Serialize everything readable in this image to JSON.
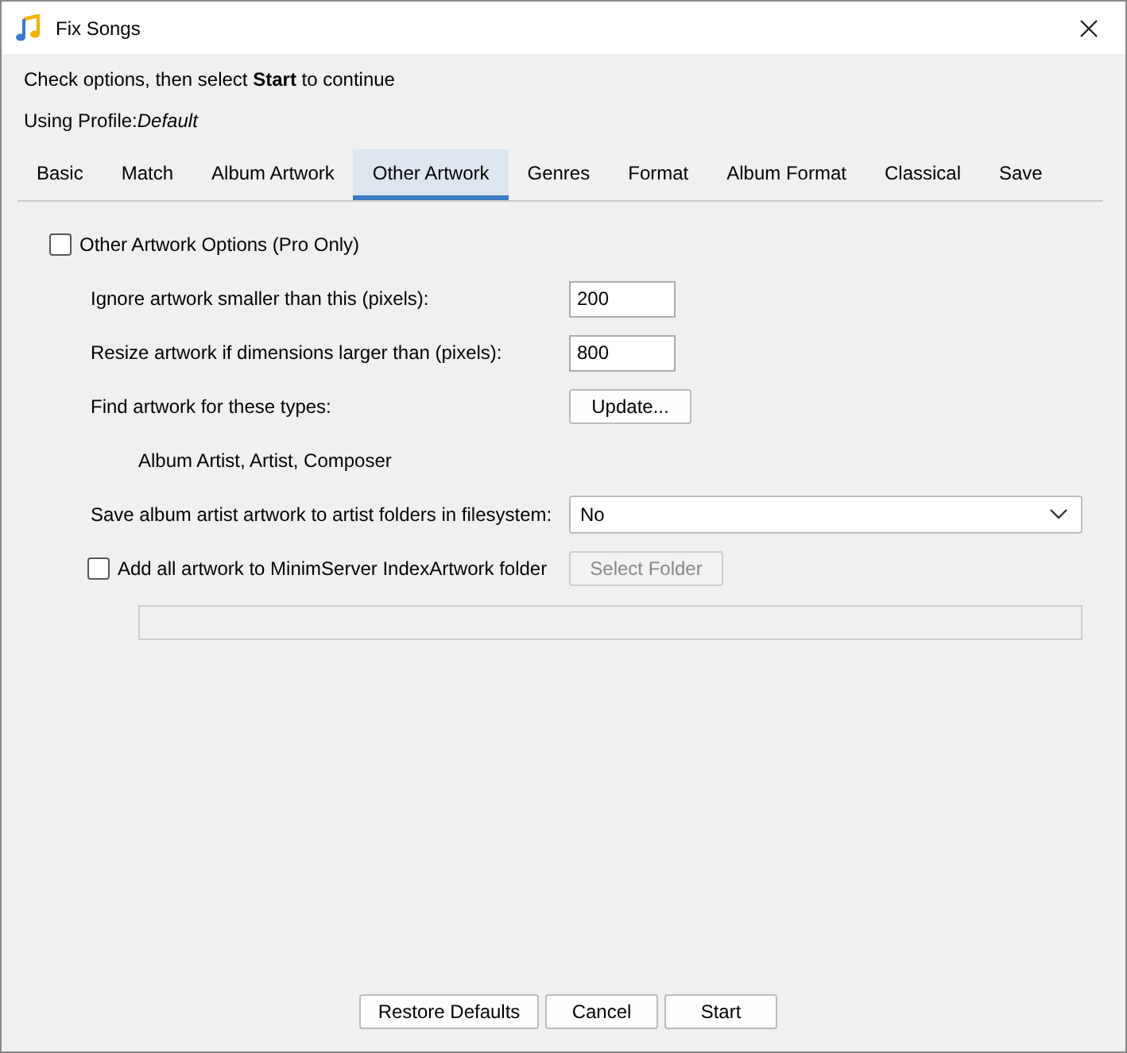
{
  "window": {
    "title": "Fix Songs"
  },
  "instruction": "Check options, then select **Start** to continue",
  "profile": "Using Profile:*Default*",
  "tabs": [
    {
      "label": "Basic",
      "selected": false
    },
    {
      "label": "Match",
      "selected": false
    },
    {
      "label": "Album Artwork",
      "selected": false
    },
    {
      "label": "Other Artwork",
      "selected": true
    },
    {
      "label": "Genres",
      "selected": false
    },
    {
      "label": "Format",
      "selected": false
    },
    {
      "label": "Album Format",
      "selected": false
    },
    {
      "label": "Classical",
      "selected": false
    },
    {
      "label": "Save",
      "selected": false
    }
  ],
  "pro_option": {
    "label": "Other Artwork Options (Pro Only)",
    "checked": false
  },
  "rows": [
    {
      "kind": "input",
      "label": "Ignore artwork smaller than this (pixels):",
      "value": "200"
    },
    {
      "kind": "input",
      "label": "Resize artwork if dimensions larger than (pixels):",
      "value": "800"
    },
    {
      "kind": "button",
      "label": "Find artwork for these types:",
      "button": "Update..."
    },
    {
      "kind": "note",
      "text": "Album Artist, Artist, Composer"
    },
    {
      "kind": "select",
      "label": "Save album artist artwork to artist folders in filesystem:",
      "value": "No"
    },
    {
      "kind": "checkfolder",
      "label": "Add all artwork to MinimServer IndexArtwork folder",
      "checked": false,
      "button": "Select Folder",
      "disabled": true
    },
    {
      "kind": "path",
      "disabled": true
    }
  ],
  "buttons": [
    "Restore Defaults",
    "Cancel",
    "Start"
  ]
}
